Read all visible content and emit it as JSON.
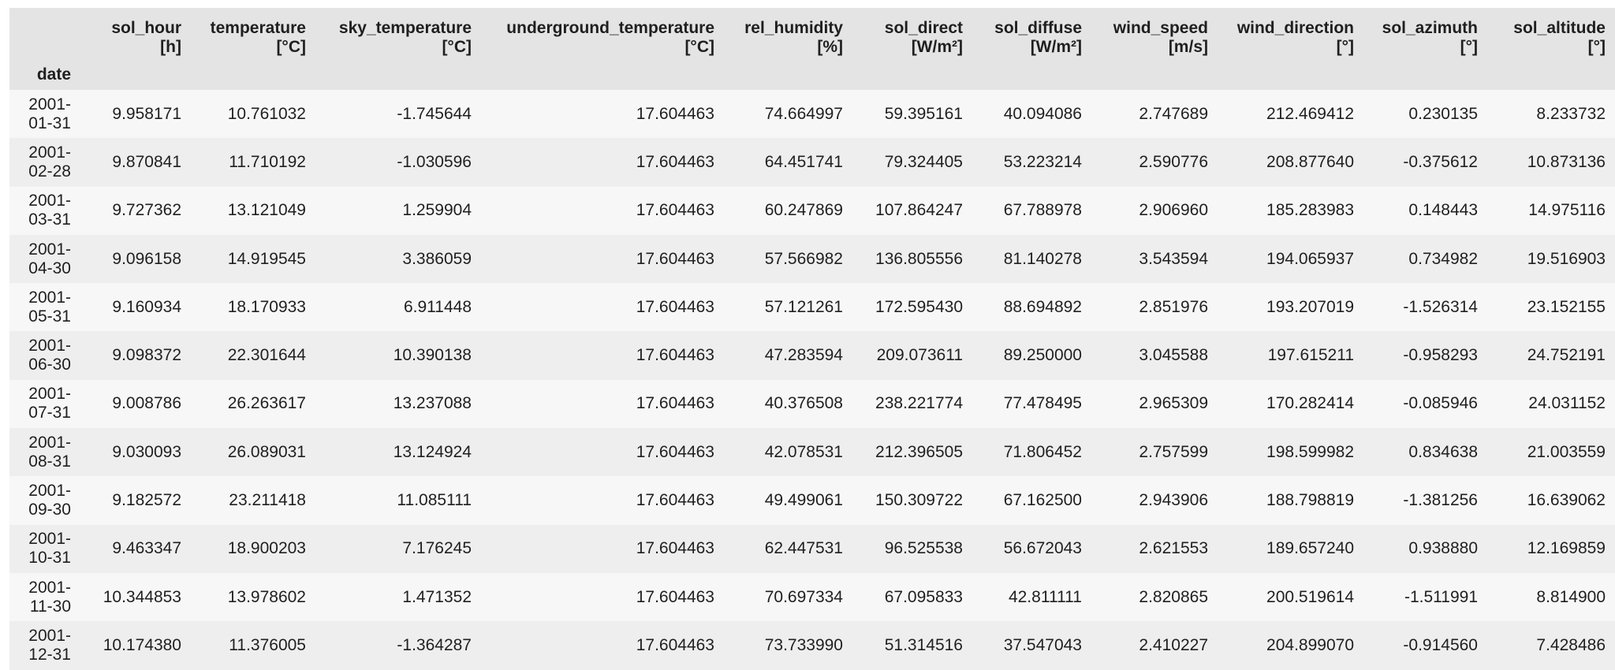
{
  "index_name": "date",
  "columns": [
    {
      "name": "sol_hour",
      "unit": "[h]"
    },
    {
      "name": "temperature",
      "unit": "[°C]"
    },
    {
      "name": "sky_temperature",
      "unit": "[°C]"
    },
    {
      "name": "underground_temperature",
      "unit": "[°C]"
    },
    {
      "name": "rel_humidity",
      "unit": "[%]"
    },
    {
      "name": "sol_direct",
      "unit": "[W/m²]"
    },
    {
      "name": "sol_diffuse",
      "unit": "[W/m²]"
    },
    {
      "name": "wind_speed",
      "unit": "[m/s]"
    },
    {
      "name": "wind_direction",
      "unit": "[°]"
    },
    {
      "name": "sol_azimuth",
      "unit": "[°]"
    },
    {
      "name": "sol_altitude",
      "unit": "[°]"
    }
  ],
  "rows": [
    {
      "date_top": "2001-",
      "date_bottom": "01-31",
      "values": [
        "9.958171",
        "10.761032",
        "-1.745644",
        "17.604463",
        "74.664997",
        "59.395161",
        "40.094086",
        "2.747689",
        "212.469412",
        "0.230135",
        "8.233732"
      ]
    },
    {
      "date_top": "2001-",
      "date_bottom": "02-28",
      "values": [
        "9.870841",
        "11.710192",
        "-1.030596",
        "17.604463",
        "64.451741",
        "79.324405",
        "53.223214",
        "2.590776",
        "208.877640",
        "-0.375612",
        "10.873136"
      ]
    },
    {
      "date_top": "2001-",
      "date_bottom": "03-31",
      "values": [
        "9.727362",
        "13.121049",
        "1.259904",
        "17.604463",
        "60.247869",
        "107.864247",
        "67.788978",
        "2.906960",
        "185.283983",
        "0.148443",
        "14.975116"
      ]
    },
    {
      "date_top": "2001-",
      "date_bottom": "04-30",
      "values": [
        "9.096158",
        "14.919545",
        "3.386059",
        "17.604463",
        "57.566982",
        "136.805556",
        "81.140278",
        "3.543594",
        "194.065937",
        "0.734982",
        "19.516903"
      ]
    },
    {
      "date_top": "2001-",
      "date_bottom": "05-31",
      "values": [
        "9.160934",
        "18.170933",
        "6.911448",
        "17.604463",
        "57.121261",
        "172.595430",
        "88.694892",
        "2.851976",
        "193.207019",
        "-1.526314",
        "23.152155"
      ]
    },
    {
      "date_top": "2001-",
      "date_bottom": "06-30",
      "values": [
        "9.098372",
        "22.301644",
        "10.390138",
        "17.604463",
        "47.283594",
        "209.073611",
        "89.250000",
        "3.045588",
        "197.615211",
        "-0.958293",
        "24.752191"
      ]
    },
    {
      "date_top": "2001-",
      "date_bottom": "07-31",
      "values": [
        "9.008786",
        "26.263617",
        "13.237088",
        "17.604463",
        "40.376508",
        "238.221774",
        "77.478495",
        "2.965309",
        "170.282414",
        "-0.085946",
        "24.031152"
      ]
    },
    {
      "date_top": "2001-",
      "date_bottom": "08-31",
      "values": [
        "9.030093",
        "26.089031",
        "13.124924",
        "17.604463",
        "42.078531",
        "212.396505",
        "71.806452",
        "2.757599",
        "198.599982",
        "0.834638",
        "21.003559"
      ]
    },
    {
      "date_top": "2001-",
      "date_bottom": "09-30",
      "values": [
        "9.182572",
        "23.211418",
        "11.085111",
        "17.604463",
        "49.499061",
        "150.309722",
        "67.162500",
        "2.943906",
        "188.798819",
        "-1.381256",
        "16.639062"
      ]
    },
    {
      "date_top": "2001-",
      "date_bottom": "10-31",
      "values": [
        "9.463347",
        "18.900203",
        "7.176245",
        "17.604463",
        "62.447531",
        "96.525538",
        "56.672043",
        "2.621553",
        "189.657240",
        "0.938880",
        "12.169859"
      ]
    },
    {
      "date_top": "2001-",
      "date_bottom": "11-30",
      "values": [
        "10.344853",
        "13.978602",
        "1.471352",
        "17.604463",
        "70.697334",
        "67.095833",
        "42.811111",
        "2.820865",
        "200.519614",
        "-1.511991",
        "8.814900"
      ]
    },
    {
      "date_top": "2001-",
      "date_bottom": "12-31",
      "values": [
        "10.174380",
        "11.376005",
        "-1.364287",
        "17.604463",
        "73.733990",
        "51.314516",
        "37.547043",
        "2.410227",
        "204.899070",
        "-0.914560",
        "7.428486"
      ]
    }
  ]
}
